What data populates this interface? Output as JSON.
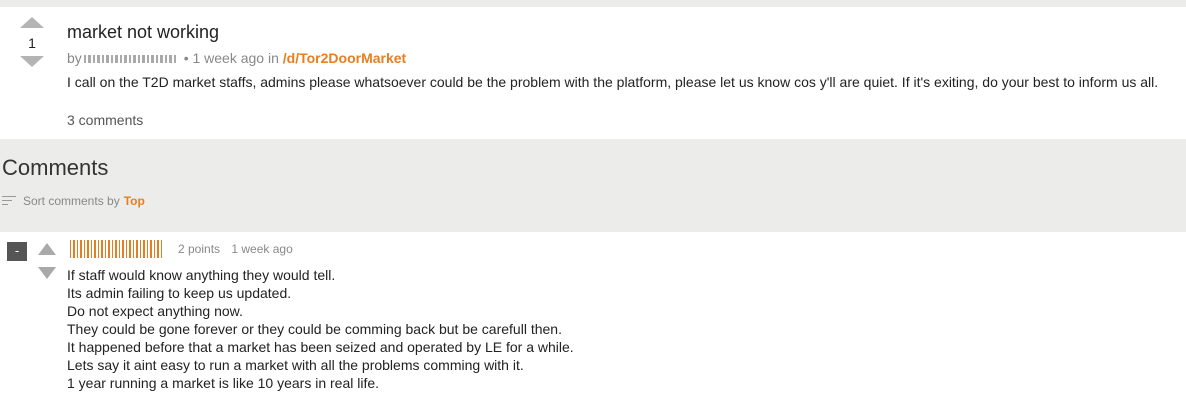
{
  "post": {
    "score": "1",
    "title": "market not working",
    "by_label": "by",
    "age": "• 1 week ago",
    "in_label": "in",
    "subforum": "/d/Tor2DoorMarket",
    "body": "I call on the T2D market staffs, admins please whatsoever could be the problem with the platform, please let us know cos y'll are quiet. If it's exiting, do your best to inform us all.",
    "comments_link": "3 comments"
  },
  "comments_section": {
    "heading": "Comments",
    "sort_label": "Sort comments by",
    "sort_value": "Top"
  },
  "comment": {
    "collapse_label": "-",
    "points": "2 points",
    "age": "1 week ago",
    "lines": [
      "If staff would know anything they would tell.",
      "Its admin failing to keep us updated.",
      "Do not expect anything now.",
      "They could be gone forever or they could be comming back but be carefull then.",
      "It happened before that a market has been seized and operated by LE for a while.",
      "Lets say it aint easy to run a market with all the problems comming with it.",
      "1 year running a market is like 10 years in real life."
    ]
  },
  "colors": {
    "accent": "#e67e22",
    "background_gray": "#ececea"
  }
}
